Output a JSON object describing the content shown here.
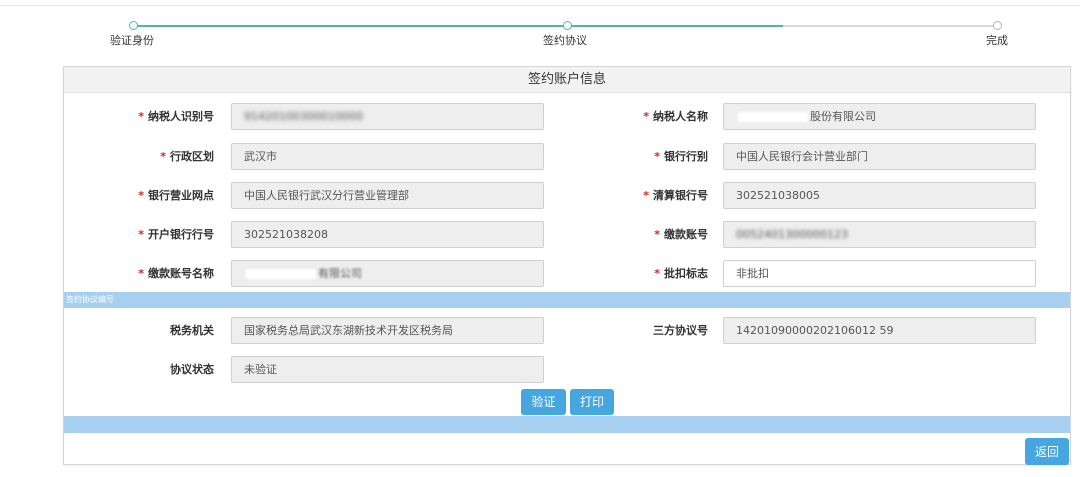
{
  "steps": [
    {
      "label": "验证身份",
      "state": "done"
    },
    {
      "label": "签约协议",
      "state": "current"
    },
    {
      "label": "完成",
      "state": "todo"
    }
  ],
  "panel": {
    "title": "签约账户信息"
  },
  "account": {
    "taxpayer_id": {
      "label": "纳税人识别号",
      "value": "91420100300010000"
    },
    "taxpayer_name": {
      "label": "纳税人名称",
      "value": "股份有限公司"
    },
    "district": {
      "label": "行政区划",
      "value": "武汉市"
    },
    "bank_type": {
      "label": "银行行别",
      "value": "中国人民银行会计营业部门"
    },
    "bank_branch": {
      "label": "银行营业网点",
      "value": "中国人民银行武汉分行营业管理部"
    },
    "clearing_bank_no": {
      "label": "清算银行号",
      "value": "302521038005"
    },
    "opening_bank_no": {
      "label": "开户银行行号",
      "value": "302521038208"
    },
    "payment_account": {
      "label": "缴款账号",
      "value": "0052401300000123"
    },
    "payment_account_name": {
      "label": "缴款账号名称",
      "value": "有限公司"
    },
    "batch_flag": {
      "label": "批扣标志",
      "value": "非批扣"
    }
  },
  "agreement": {
    "section_title": "签约协议编号",
    "tax_authority": {
      "label": "税务机关",
      "value": "国家税务总局武汉东湖新技术开发区税务局"
    },
    "tripartite_no": {
      "label": "三方协议号",
      "value": "14201090000202106012 59"
    },
    "status": {
      "label": "协议状态",
      "value": "未验证"
    }
  },
  "buttons": {
    "verify": "验证",
    "print": "打印",
    "back": "返回"
  },
  "colors": {
    "accent": "#46a6df",
    "stepper": "#4fb99f",
    "section_bar": "#a6cff0",
    "required": "#e02020"
  }
}
